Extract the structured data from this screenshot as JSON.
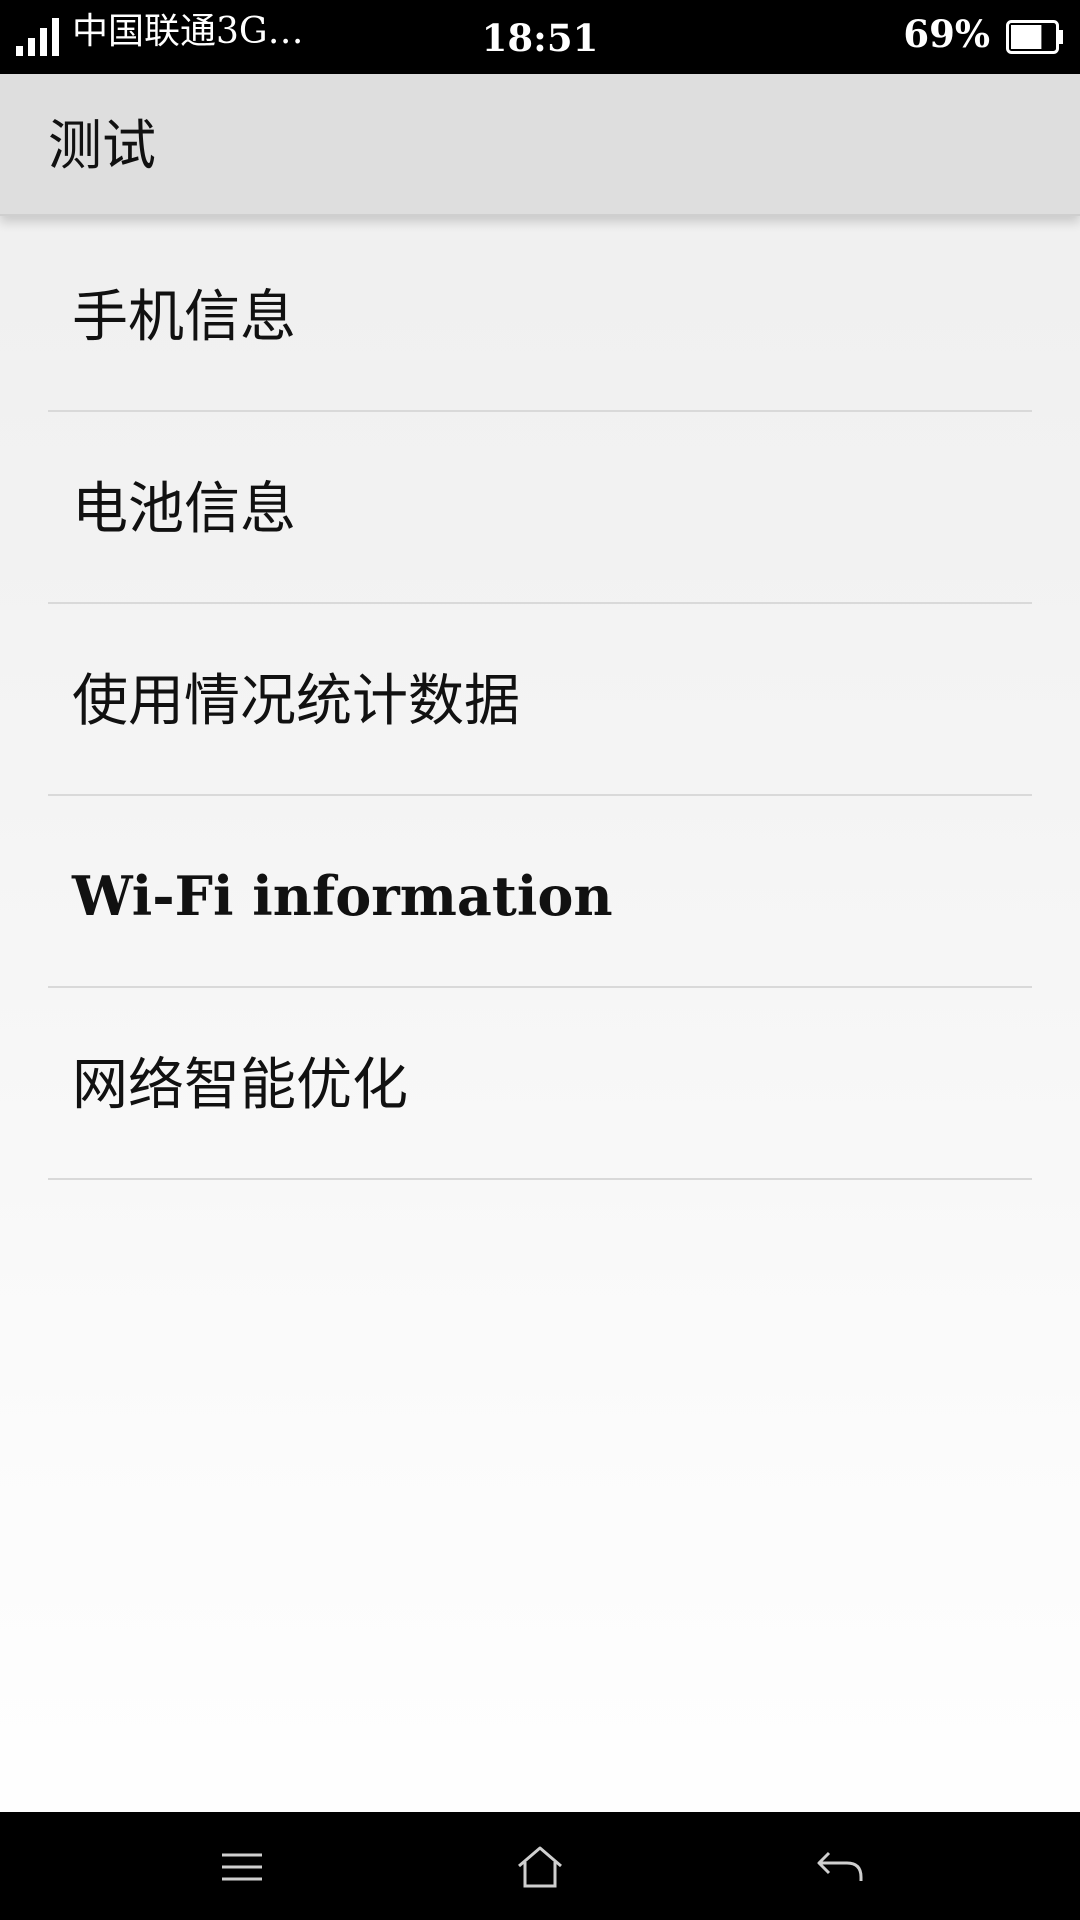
{
  "status_bar": {
    "carrier": "中国联通3G…",
    "time": "18:51",
    "battery_percent": "69%",
    "battery_level": 0.69,
    "signal_bars": 4,
    "icons": [
      "signal-icon",
      "battery-icon"
    ]
  },
  "action_bar": {
    "title": "测试"
  },
  "list": {
    "items": [
      {
        "label": "手机信息"
      },
      {
        "label": "电池信息"
      },
      {
        "label": "使用情况统计数据"
      },
      {
        "label": "Wi-Fi information"
      },
      {
        "label": "网络智能优化"
      }
    ]
  },
  "nav_bar": {
    "icons": [
      "menu-icon",
      "home-icon",
      "back-icon"
    ]
  },
  "colors": {
    "status_bar_bg": "#000000",
    "action_bar_bg": "#dedede",
    "text": "#111111",
    "divider": "#d9d9d9"
  }
}
